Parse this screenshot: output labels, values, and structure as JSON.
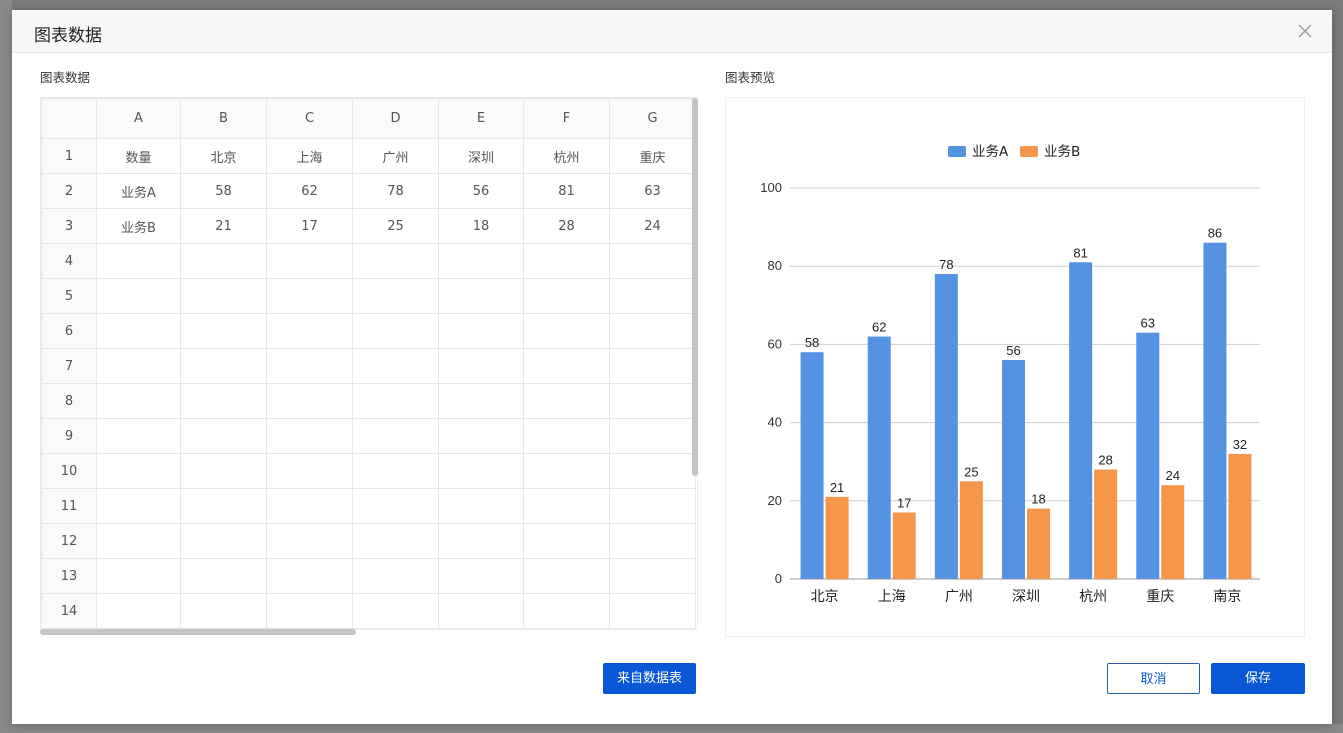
{
  "dialog": {
    "title": "图表数据",
    "left_label": "图表数据",
    "right_label": "图表预览",
    "buttons": {
      "from_table": "来自数据表",
      "cancel": "取消",
      "save": "保存"
    }
  },
  "sheet": {
    "columns": [
      "A",
      "B",
      "C",
      "D",
      "E",
      "F",
      "G"
    ],
    "rows": [
      [
        "数量",
        "北京",
        "上海",
        "广州",
        "深圳",
        "杭州",
        "重庆"
      ],
      [
        "业务A",
        "58",
        "62",
        "78",
        "56",
        "81",
        "63"
      ],
      [
        "业务B",
        "21",
        "17",
        "25",
        "18",
        "28",
        "24"
      ],
      [
        "",
        "",
        "",
        "",
        "",
        "",
        ""
      ],
      [
        "",
        "",
        "",
        "",
        "",
        "",
        ""
      ],
      [
        "",
        "",
        "",
        "",
        "",
        "",
        ""
      ],
      [
        "",
        "",
        "",
        "",
        "",
        "",
        ""
      ],
      [
        "",
        "",
        "",
        "",
        "",
        "",
        ""
      ],
      [
        "",
        "",
        "",
        "",
        "",
        "",
        ""
      ],
      [
        "",
        "",
        "",
        "",
        "",
        "",
        ""
      ],
      [
        "",
        "",
        "",
        "",
        "",
        "",
        ""
      ],
      [
        "",
        "",
        "",
        "",
        "",
        "",
        ""
      ],
      [
        "",
        "",
        "",
        "",
        "",
        "",
        ""
      ],
      [
        "",
        "",
        "",
        "",
        "",
        "",
        ""
      ]
    ]
  },
  "chart_data": {
    "type": "bar",
    "categories": [
      "北京",
      "上海",
      "广州",
      "深圳",
      "杭州",
      "重庆",
      "南京"
    ],
    "series": [
      {
        "name": "业务A",
        "values": [
          58,
          62,
          78,
          56,
          81,
          63,
          86
        ],
        "color": "#5592e1"
      },
      {
        "name": "业务B",
        "values": [
          21,
          17,
          25,
          18,
          28,
          24,
          32
        ],
        "color": "#f5964a"
      }
    ],
    "ylim": [
      0,
      100
    ],
    "yticks": [
      0,
      20,
      40,
      60,
      80,
      100
    ],
    "grid": true,
    "legend": "top-center",
    "data_labels": true
  },
  "colors": {
    "primary": "#0a57d6",
    "series_a": "#5592e1",
    "series_b": "#f5964a"
  }
}
